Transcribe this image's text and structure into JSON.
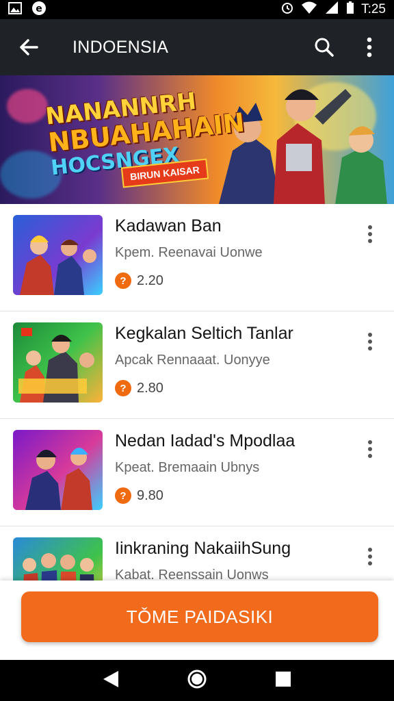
{
  "status_bar": {
    "time": "T:25"
  },
  "app_bar": {
    "title": "INDOENSIA"
  },
  "banner": {
    "title_lines": [
      "NANANNRH",
      "NBUAHAHAIN",
      "HOCSNGEX"
    ],
    "subtitle": "BIRUN KAISAR"
  },
  "items": [
    {
      "title": "Kadawan Ban",
      "subtitle": "Kpem. Reenavai Uonwe",
      "rating": "2.20"
    },
    {
      "title": "Kegkalan Seltich Tanlar",
      "subtitle": "Apcak Rennaaat. Uonyye",
      "rating": "2.80"
    },
    {
      "title": "Nedan Iadad's Mpodlaa",
      "subtitle": "Kpeat. Bremaain Ubnys",
      "rating": "9.80"
    },
    {
      "title": "Iinkraning NakaiihSung",
      "subtitle": "Kabat. Reenssain Uonws",
      "rating": ""
    }
  ],
  "cta": {
    "label": "TǑME PAIDASIKI"
  },
  "colors": {
    "accent": "#f26a1b",
    "app_bar": "#1f2327"
  }
}
